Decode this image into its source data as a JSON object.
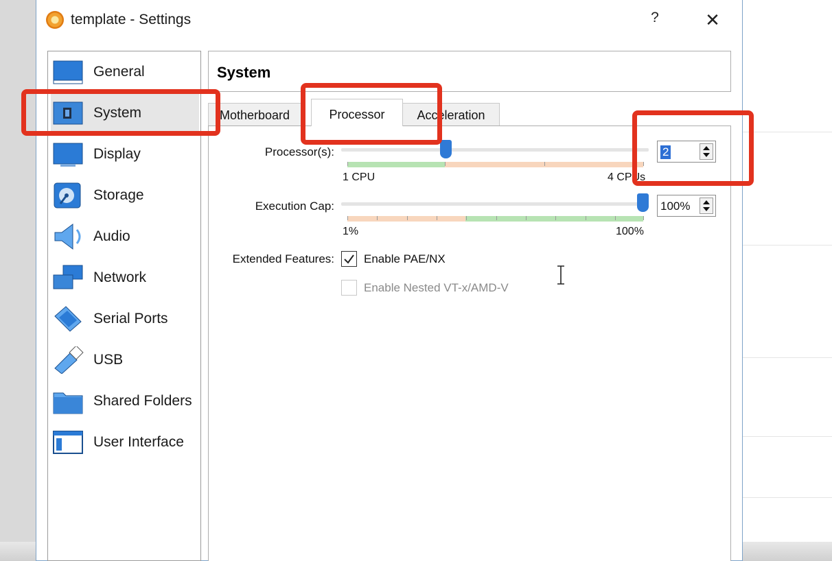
{
  "window": {
    "title": "template - Settings",
    "help_label": "?",
    "close_label": "✕"
  },
  "sidebar": {
    "items": [
      {
        "label": "General",
        "icon": "general-icon"
      },
      {
        "label": "System",
        "icon": "system-icon",
        "selected": true
      },
      {
        "label": "Display",
        "icon": "display-icon"
      },
      {
        "label": "Storage",
        "icon": "storage-icon"
      },
      {
        "label": "Audio",
        "icon": "audio-icon"
      },
      {
        "label": "Network",
        "icon": "network-icon"
      },
      {
        "label": "Serial Ports",
        "icon": "serial-ports-icon"
      },
      {
        "label": "USB",
        "icon": "usb-icon"
      },
      {
        "label": "Shared Folders",
        "icon": "shared-folders-icon"
      },
      {
        "label": "User Interface",
        "icon": "user-interface-icon"
      }
    ]
  },
  "main": {
    "title": "System",
    "tabs": [
      {
        "label": "Motherboard"
      },
      {
        "label": "Processor",
        "active": true
      },
      {
        "label": "Acceleration"
      }
    ],
    "processors": {
      "label": "Processor(s):",
      "value": "2",
      "min_label": "1 CPU",
      "max_label": "4 CPUs",
      "min": 1,
      "max": 4
    },
    "execution_cap": {
      "label": "Execution Cap:",
      "value": "100%",
      "min_label": "1%",
      "max_label": "100%",
      "percent": 100
    },
    "extended_features": {
      "label": "Extended Features:",
      "pae_label": "Enable PAE/NX",
      "pae_checked": true,
      "nested_label": "Enable Nested VT-x/AMD-V",
      "nested_checked": false,
      "nested_enabled": false
    }
  },
  "colors": {
    "highlight": "#e2321e",
    "slider_thumb": "#2f7ad6",
    "range_good": "#b7e3b3",
    "range_warn": "#f8d6bd",
    "selection": "#2d6fd4"
  }
}
